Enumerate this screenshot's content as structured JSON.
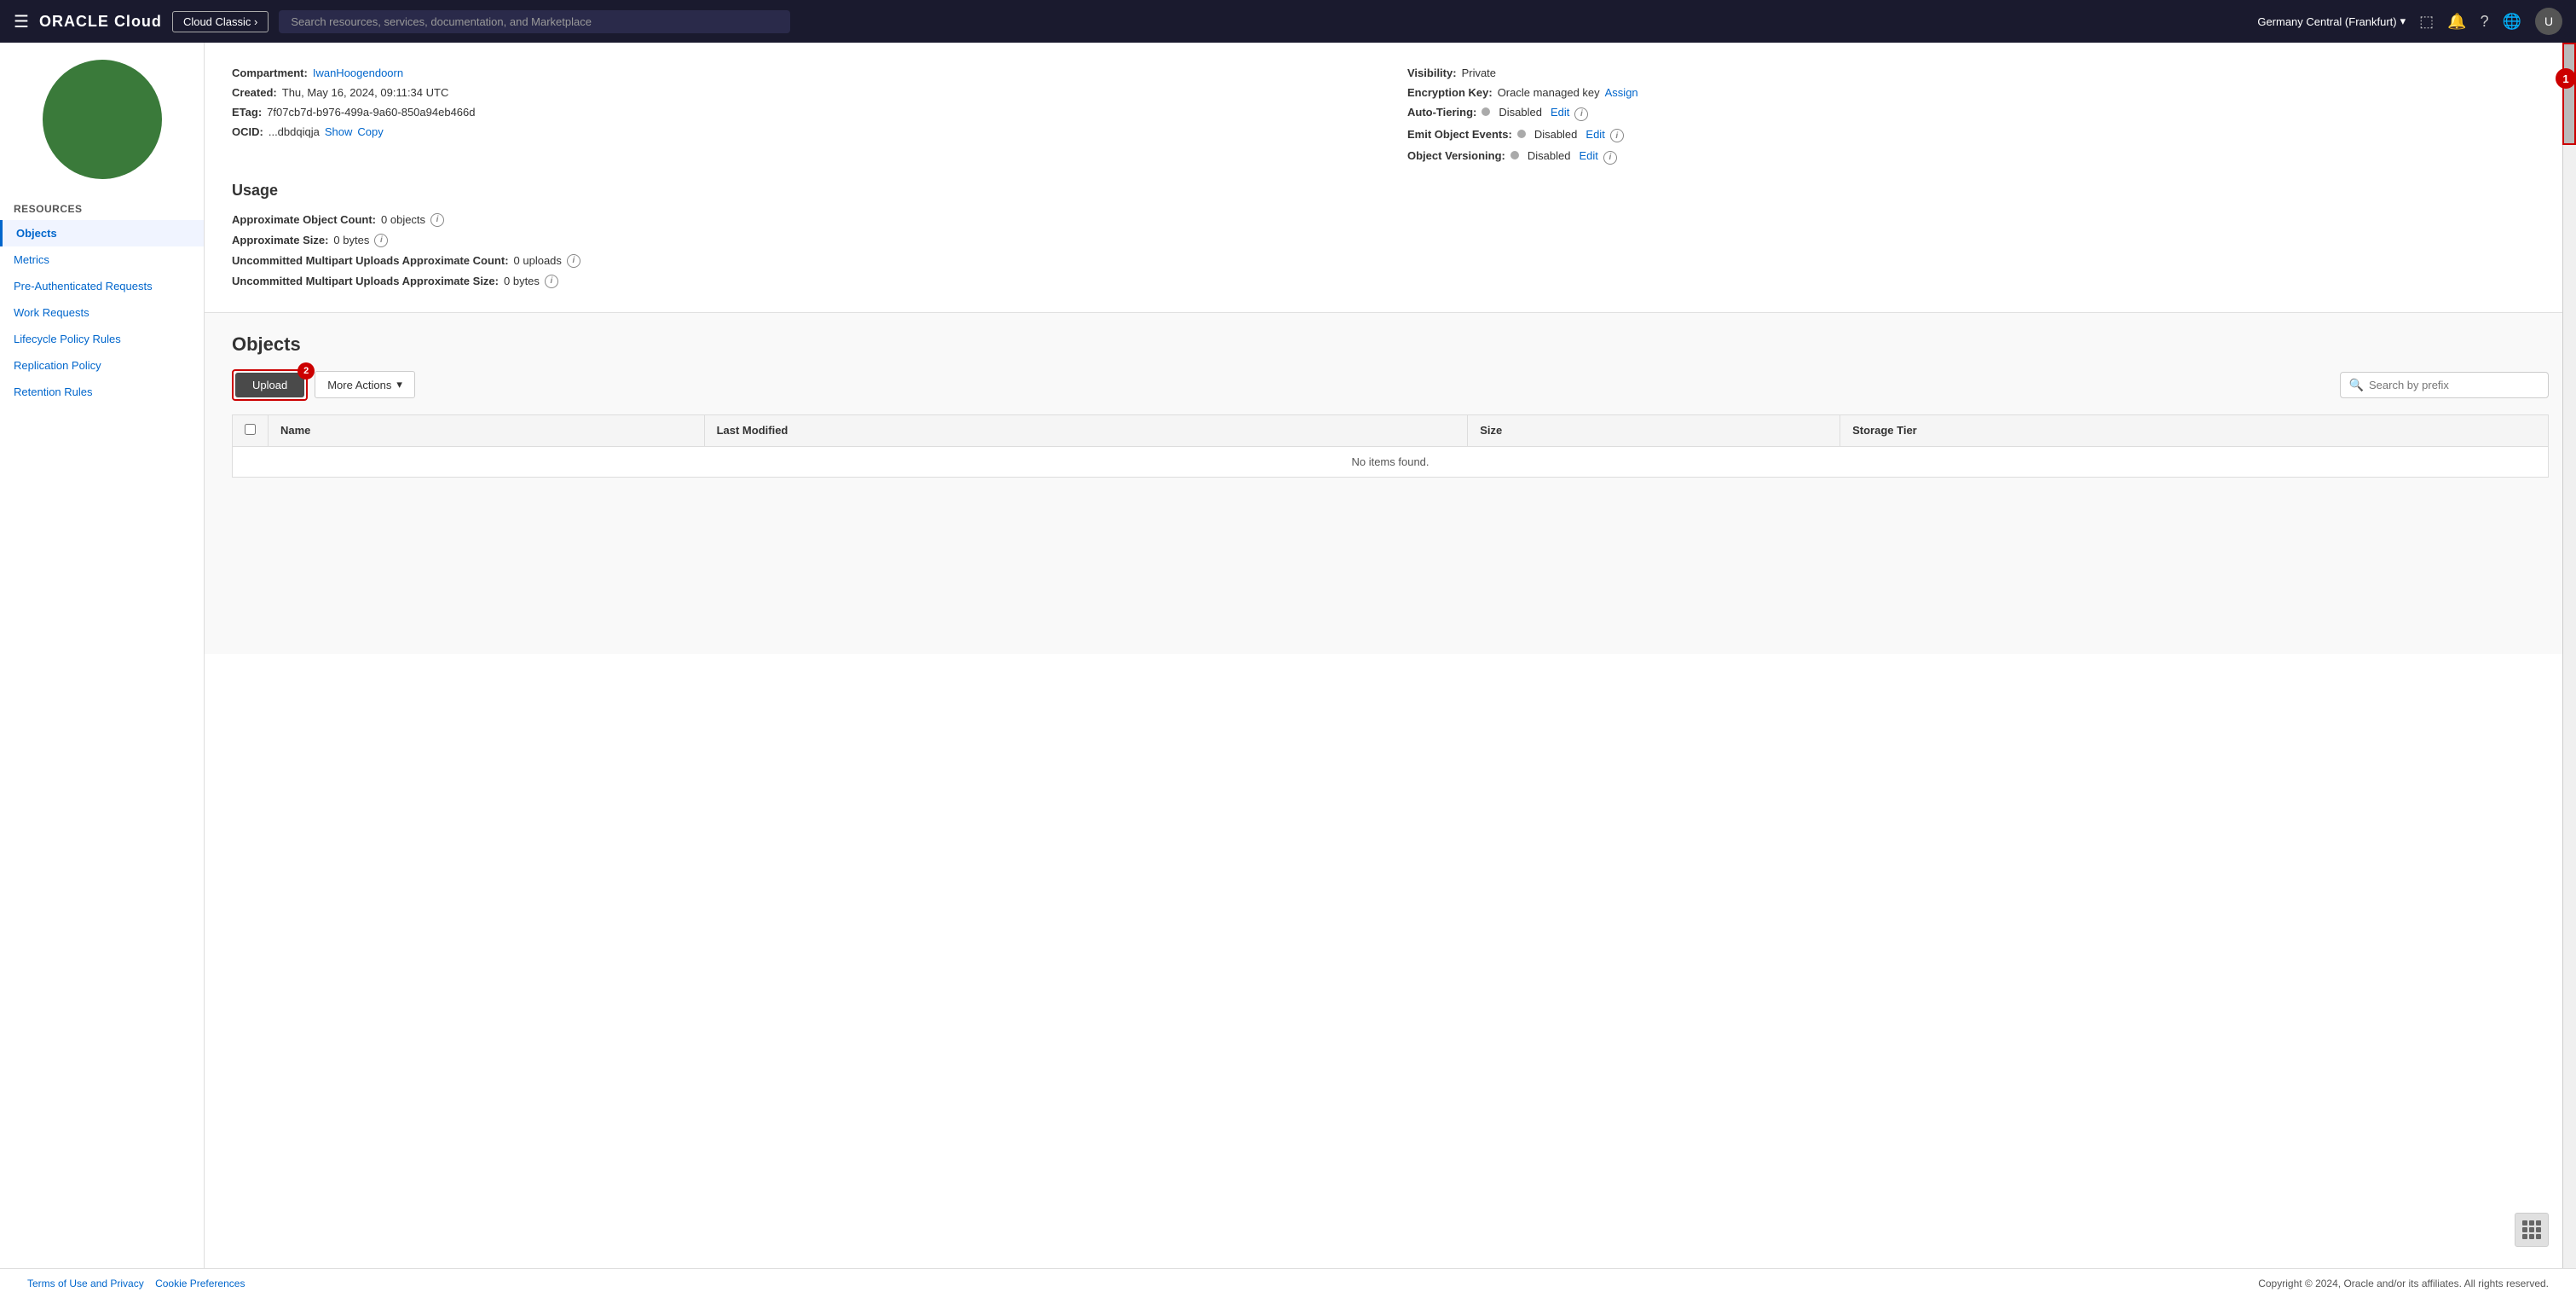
{
  "nav": {
    "hamburger_label": "☰",
    "logo": "ORACLE Cloud",
    "classic_btn": "Cloud Classic ›",
    "search_placeholder": "Search resources, services, documentation, and Marketplace",
    "region": "Germany Central (Frankfurt)",
    "chevron": "▾"
  },
  "detail": {
    "compartment_label": "Compartment:",
    "compartment_value": "IwanHoogendoorn",
    "created_label": "Created:",
    "created_value": "Thu, May 16, 2024, 09:11:34 UTC",
    "etag_label": "ETag:",
    "etag_value": "7f07cb7d-b976-499a-9a60-850a94eb466d",
    "ocid_label": "OCID:",
    "ocid_value": "...dbdqiqja",
    "show_link": "Show",
    "copy_link": "Copy",
    "visibility_label": "Visibility:",
    "visibility_value": "Private",
    "encryption_label": "Encryption Key:",
    "encryption_value": "Oracle managed key",
    "assign_link": "Assign",
    "auto_tiering_label": "Auto-Tiering:",
    "auto_tiering_value": "Disabled",
    "auto_tiering_edit": "Edit",
    "emit_events_label": "Emit Object Events:",
    "emit_events_value": "Disabled",
    "emit_events_edit": "Edit",
    "obj_versioning_label": "Object Versioning:",
    "obj_versioning_value": "Disabled",
    "obj_versioning_edit": "Edit"
  },
  "usage": {
    "title": "Usage",
    "obj_count_label": "Approximate Object Count:",
    "obj_count_value": "0 objects",
    "size_label": "Approximate Size:",
    "size_value": "0 bytes",
    "multipart_count_label": "Uncommitted Multipart Uploads Approximate Count:",
    "multipart_count_value": "0 uploads",
    "multipart_size_label": "Uncommitted Multipart Uploads Approximate Size:",
    "multipart_size_value": "0 bytes"
  },
  "objects": {
    "section_title": "Objects",
    "upload_btn": "Upload",
    "more_actions_btn": "More Actions",
    "search_placeholder": "Search by prefix",
    "table_headers": [
      "Name",
      "Last Modified",
      "Size",
      "Storage Tier"
    ],
    "no_items_text": "No items found.",
    "badge_upload": "2",
    "badge_scrollbar": "1"
  },
  "sidebar": {
    "resources_title": "Resources",
    "items": [
      {
        "label": "Objects",
        "active": true
      },
      {
        "label": "Metrics",
        "active": false
      },
      {
        "label": "Pre-Authenticated Requests",
        "active": false
      },
      {
        "label": "Work Requests",
        "active": false
      },
      {
        "label": "Lifecycle Policy Rules",
        "active": false
      },
      {
        "label": "Replication Policy",
        "active": false
      },
      {
        "label": "Retention Rules",
        "active": false
      }
    ]
  },
  "footer": {
    "terms_link": "Terms of Use and Privacy",
    "cookies_link": "Cookie Preferences",
    "copyright": "Copyright © 2024, Oracle and/or its affiliates. All rights reserved."
  }
}
